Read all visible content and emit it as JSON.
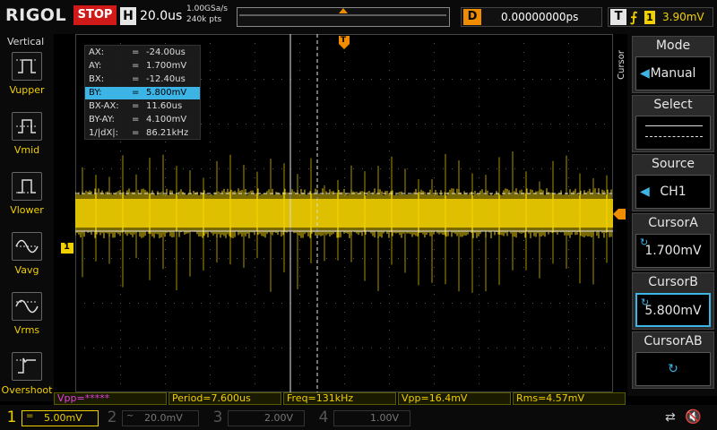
{
  "topbar": {
    "logo": "RIGOL",
    "run_state": "STOP",
    "timebase_label": "H",
    "timebase": "20.0us",
    "sample_rate": "1.00GSa/s",
    "memory_depth": "240k pts",
    "delay_label": "D",
    "delay": "0.00000000ps",
    "trigger_label": "T",
    "trigger_icon": "rising-edge-icon",
    "trigger_channel": "1",
    "trigger_level": "3.90mV"
  },
  "left_panel": {
    "title": "Vertical",
    "items": [
      {
        "label": "Vupper",
        "icon": "vupper-icon"
      },
      {
        "label": "Vmid",
        "icon": "vmid-icon"
      },
      {
        "label": "Vlower",
        "icon": "vlower-icon"
      },
      {
        "label": "Vavg",
        "icon": "vavg-icon"
      },
      {
        "label": "Vrms",
        "icon": "vrms-icon"
      },
      {
        "label": "Overshoot",
        "icon": "overshoot-icon"
      }
    ]
  },
  "cursor_readout": [
    {
      "key": "AX:",
      "value": "-24.00us"
    },
    {
      "key": "AY:",
      "value": "1.700mV"
    },
    {
      "key": "BX:",
      "value": "-12.40us"
    },
    {
      "key": "BY:",
      "value": "5.800mV"
    },
    {
      "key": "BX-AX:",
      "value": "11.60us"
    },
    {
      "key": "BY-AY:",
      "value": "4.100mV"
    },
    {
      "key": "1/|dX|:",
      "value": "86.21kHz"
    }
  ],
  "cursor_eq": "=",
  "screen_markers": {
    "trigger_pos_marker": "T",
    "channel1_marker": "1"
  },
  "right_menu": {
    "vertical_label": "Cursor",
    "mode": {
      "title": "Mode",
      "value": "Manual"
    },
    "select": {
      "title": "Select"
    },
    "source": {
      "title": "Source",
      "value": "CH1"
    },
    "cursor_a": {
      "title": "CursorA",
      "value": "1.700mV"
    },
    "cursor_b": {
      "title": "CursorB",
      "value": "5.800mV"
    },
    "cursor_ab": {
      "title": "CursorAB"
    }
  },
  "measurements": [
    {
      "text": "Vpp=*****"
    },
    {
      "text": "Period=7.600us"
    },
    {
      "text": "Freq=131kHz"
    },
    {
      "text": "Vpp=16.4mV"
    },
    {
      "text": "Rms=4.57mV"
    }
  ],
  "channels": [
    {
      "num": "1",
      "coupling": "=",
      "scale": "5.00mV",
      "color": "#f0d000"
    },
    {
      "num": "2",
      "coupling": "~",
      "scale": "20.0mV",
      "color": "#26c6da"
    },
    {
      "num": "3",
      "coupling": "",
      "scale": "2.00V",
      "color": "#c040c0"
    },
    {
      "num": "4",
      "coupling": "",
      "scale": "1.00V",
      "color": "#4c6fd8"
    }
  ],
  "colors": {
    "ch1": "#f0d000",
    "trigger": "#f08c00",
    "accent": "#3cb4e6",
    "stop": "#d01a1a"
  }
}
